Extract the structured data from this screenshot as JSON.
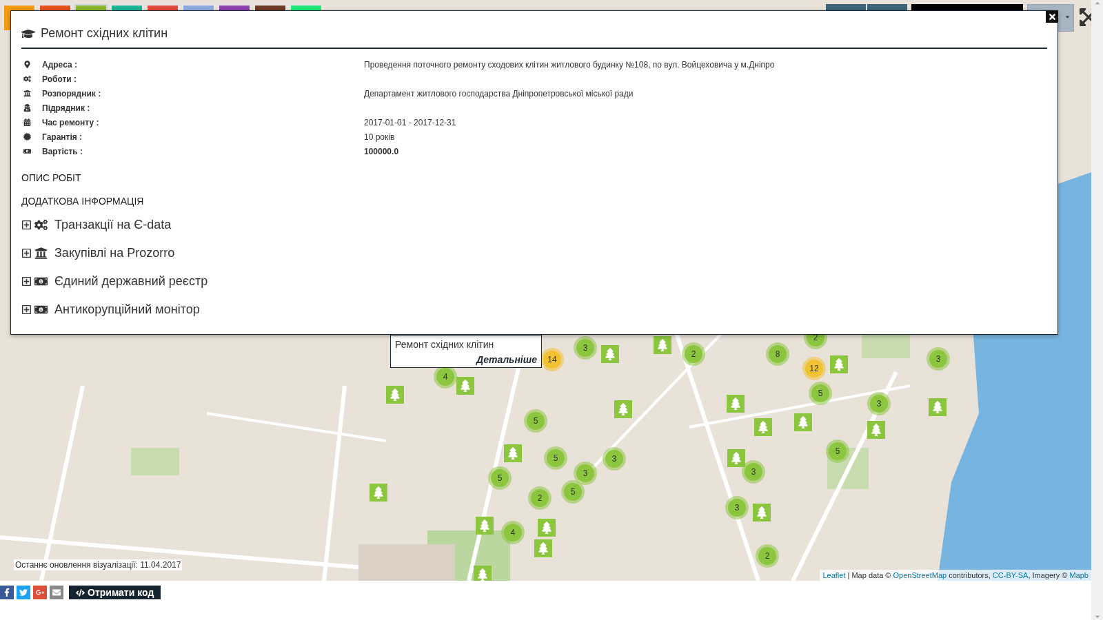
{
  "layer_tabs": [
    {
      "color": "#f39c12",
      "selected": false
    },
    {
      "color": "#e8501e",
      "selected": false
    },
    {
      "color": "#8bb82b",
      "selected": true
    },
    {
      "color": "#1fb394",
      "selected": false
    },
    {
      "color": "#e2483d",
      "selected": false
    },
    {
      "color": "#8fa9e0",
      "selected": false
    },
    {
      "color": "#8e44ad",
      "selected": false
    },
    {
      "color": "#6d3a26",
      "selected": false
    },
    {
      "color": "#1de97a",
      "selected": false
    }
  ],
  "modal": {
    "title": "Ремонт східних клітин",
    "details": [
      {
        "label": "Адреса :",
        "value": "Проведення поточного ремонту сходових клітин житлового будинку №108, по вул. Войцеховича у м.Дніпро",
        "bold": false
      },
      {
        "label": "Роботи :"
      },
      {
        "label": "Розпорядник :",
        "value": "Департамент житлового господарства Дніпропетровської міської ради",
        "bold": false
      },
      {
        "label": "Підрядник :"
      },
      {
        "label": "Час ремонту :",
        "value": "2017-01-01 - 2017-12-31",
        "bold": false
      },
      {
        "label": "Гарантія :",
        "value": "10 років",
        "bold": false
      },
      {
        "label": "Вартість :",
        "value": "100000.0",
        "bold": true
      }
    ],
    "sections": [
      "ОПИС РОБІТ",
      "ДОДАТКОВА ІНФОРМАЦІЯ"
    ],
    "expanders": [
      {
        "label": "Транзакції на Є-data",
        "expanded": false
      },
      {
        "label": "Закупівлі на Prozorro",
        "expanded": false
      },
      {
        "label": "Єдиний державний реєстр",
        "expanded": false
      },
      {
        "label": "Антикорупційний монітор",
        "expanded": false
      }
    ]
  },
  "popup": {
    "title": "Ремонт східних клітин",
    "link": "Детальніше"
  },
  "clusters": [
    {
      "count": "14",
      "color": "#f1c232"
    },
    {
      "count": "3",
      "color": "#8cc63f"
    },
    {
      "count": "2",
      "color": "#8cc63f"
    },
    {
      "count": "8",
      "color": "#8cc63f"
    },
    {
      "count": "2",
      "color": "#8cc63f"
    },
    {
      "count": "12",
      "color": "#f1c232"
    },
    {
      "count": "5",
      "color": "#8cc63f"
    },
    {
      "count": "3",
      "color": "#8cc63f"
    },
    {
      "count": "3",
      "color": "#8cc63f"
    },
    {
      "count": "4",
      "color": "#8cc63f"
    },
    {
      "count": "5",
      "color": "#8cc63f"
    },
    {
      "count": "5",
      "color": "#8cc63f"
    },
    {
      "count": "3",
      "color": "#8cc63f"
    },
    {
      "count": "3",
      "color": "#8cc63f"
    },
    {
      "count": "5",
      "color": "#8cc63f"
    },
    {
      "count": "2",
      "color": "#8cc63f"
    },
    {
      "count": "5",
      "color": "#8cc63f"
    },
    {
      "count": "4",
      "color": "#8cc63f"
    },
    {
      "count": "5",
      "color": "#8cc63f"
    },
    {
      "count": "3",
      "color": "#8cc63f"
    },
    {
      "count": "3",
      "color": "#8cc63f"
    },
    {
      "count": "2",
      "color": "#8cc63f"
    }
  ],
  "update_note": "Останнє оновлення візуалізації: 11.04.2017",
  "attribution": [
    {
      "kind": "link",
      "text": "Leaflet"
    },
    {
      "kind": "text",
      "text": " | Map data © "
    },
    {
      "kind": "link",
      "text": "OpenStreetMap"
    },
    {
      "kind": "text",
      "text": " contributors, "
    },
    {
      "kind": "link",
      "text": "CC-BY-SA"
    },
    {
      "kind": "text",
      "text": ", Imagery © "
    },
    {
      "kind": "link",
      "text": "Mapb"
    }
  ],
  "share": [
    {
      "kind": "facebook",
      "color": "#3b5998"
    },
    {
      "kind": "twitter",
      "color": "#1da1f2"
    },
    {
      "kind": "google",
      "color": "#dd4b39"
    },
    {
      "kind": "mail",
      "color": "#888888"
    }
  ],
  "code_button": "Отримати код"
}
